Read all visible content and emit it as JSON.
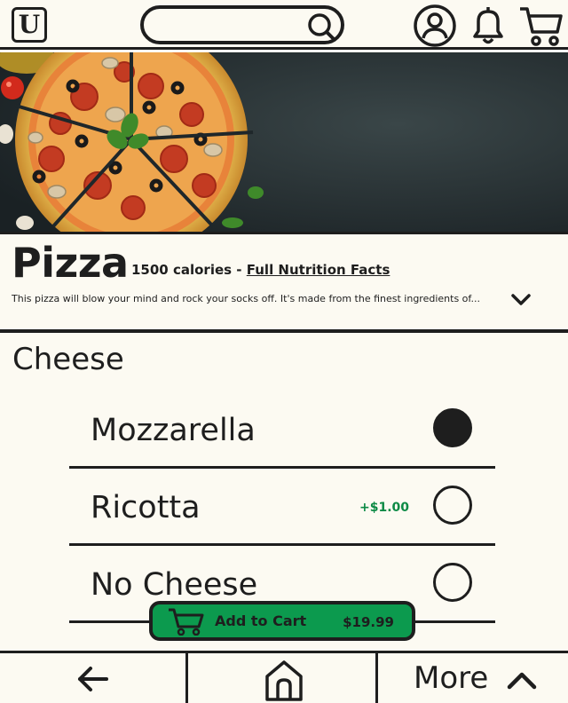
{
  "header": {
    "logo_text": "U",
    "search": {
      "value": "",
      "placeholder": ""
    },
    "icons": [
      "account-icon",
      "bell-icon",
      "cart-icon"
    ]
  },
  "product": {
    "title": "Pizza",
    "calories": "1500 calories - ",
    "nutrition_link": "Full Nutrition Facts",
    "description": "This pizza will blow your mind and rock your socks off. It's made from the finest ingredients of..."
  },
  "options": {
    "section_title": "Cheese",
    "items": [
      {
        "label": "Mozzarella",
        "price": "",
        "selected": true
      },
      {
        "label": "Ricotta",
        "price": "+$1.00",
        "selected": false
      },
      {
        "label": "No Cheese",
        "price": "",
        "selected": false
      }
    ]
  },
  "cart": {
    "label": "Add to Cart",
    "price": "$19.99"
  },
  "bottom_nav": {
    "more_label": "More"
  },
  "colors": {
    "background": "#fcfaf2",
    "ink": "#1e1e1e",
    "accent_green": "#0c9a4e",
    "price_green": "#0c8a45"
  }
}
